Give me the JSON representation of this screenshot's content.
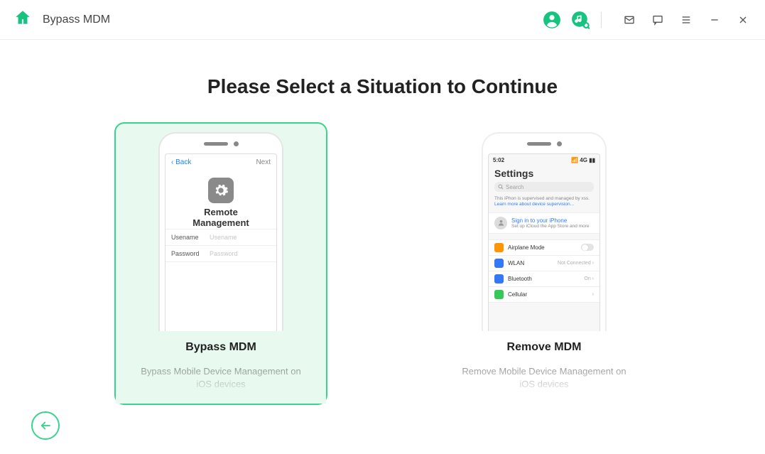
{
  "topbar": {
    "title": "Bypass MDM"
  },
  "heading": "Please Select a Situation to Continue",
  "cards": {
    "bypass": {
      "title": "Bypass MDM",
      "desc": "Bypass Mobile Device Management on iOS devices",
      "nav_back": "Back",
      "nav_next": "Next",
      "screen_title_1": "Remote",
      "screen_title_2": "Management",
      "username_label": "Usename",
      "username_ph": "Usename",
      "password_label": "Password",
      "password_ph": "Password"
    },
    "remove": {
      "title": "Remove MDM",
      "desc": "Remove Mobile Device Management on iOS devices",
      "time": "5:02",
      "status_right": "📶 4G ▮▮",
      "settings_header": "Settings",
      "search_ph": "Search",
      "supervise_a": "This iPhon is supervised and managed by xss. ",
      "supervise_b": "Learn more about device supervision...",
      "signin": "Sign in to your iPhone",
      "signin_sub": "Set up iCloud the App Store and more",
      "rows": {
        "airplane": "Airplane Mode",
        "wlan": "WLAN",
        "wlan_val": "Not Connected",
        "bt": "Bluetooth",
        "bt_val": "On",
        "cell": "Cellular"
      }
    }
  }
}
